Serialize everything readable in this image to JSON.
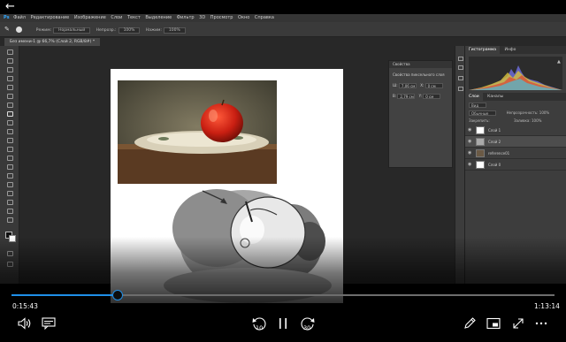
{
  "player": {
    "back_glyph": "←",
    "current_time": "0:15:43",
    "total_time": "1:13:14",
    "progress": 0.195,
    "skip_back_label": "10",
    "skip_forward_label": "30",
    "accent": "#1f8fe8"
  },
  "photoshop": {
    "logo": "Ps",
    "menu": [
      "Файл",
      "Редактирование",
      "Изображение",
      "Слои",
      "Текст",
      "Выделение",
      "Фильтр",
      "3D",
      "Просмотр",
      "Окно",
      "Справка"
    ],
    "options": {
      "mode_label": "Режим:",
      "mode_value": "Нормальный",
      "opacity_label": "Непрозр.:",
      "opacity_value": "100%",
      "flow_label": "Нажим:",
      "flow_value": "100%"
    },
    "doc_tab": "Без имени-1 @ 66,7% (Слой 2, RGB/8#) *",
    "properties": {
      "title": "Свойства",
      "subtitle": "Свойства пиксельного слоя",
      "w_label": "Ш:",
      "w_value": "7,06 см",
      "h_label": "В:",
      "h_value": "2,79 см",
      "x_label": "X:",
      "x_value": "0 см",
      "y_label": "Y:",
      "y_value": "0 см"
    },
    "right_tabs": [
      "Гистограмма",
      "Инфо"
    ],
    "layers_tabs": [
      "Слои",
      "Каналы"
    ],
    "layers_filter": "Вид",
    "blend_mode": "Обычные",
    "layers_opacity_label": "Непрозрачность:",
    "layers_opacity_value": "100%",
    "lock_label": "Закрепить:",
    "fill_label": "Заливка:",
    "fill_value": "100%",
    "layers": [
      {
        "name": "Слой 1",
        "selected": false
      },
      {
        "name": "Слой 2",
        "selected": true
      },
      {
        "name": "reference01",
        "selected": false
      },
      {
        "name": "Слой 0",
        "selected": false
      }
    ]
  },
  "icons": {
    "back": "back-arrow-icon",
    "volume": "volume-icon",
    "subtitles": "subtitles-icon",
    "skip_back": "skip-back-10-icon",
    "pause": "pause-icon",
    "skip_forward": "skip-forward-30-icon",
    "edit": "pen-icon",
    "miniview": "miniview-icon",
    "fullscreen": "fullscreen-icon",
    "more": "more-icon"
  }
}
